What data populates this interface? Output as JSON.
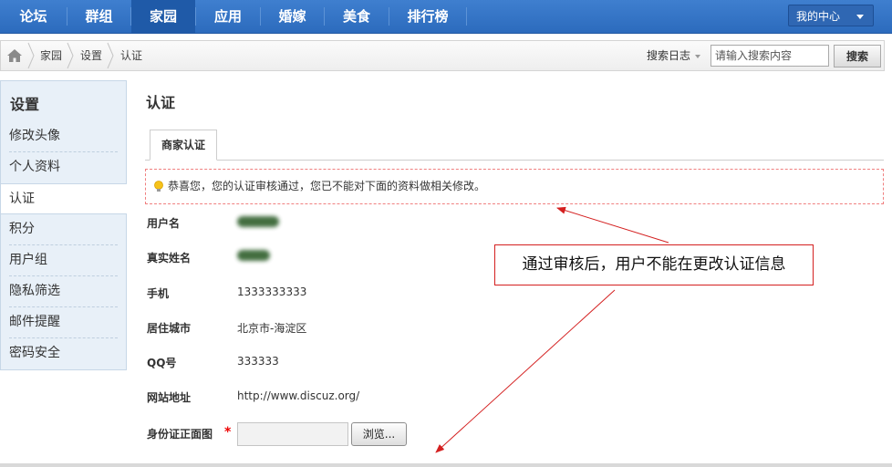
{
  "topnav": {
    "items": [
      {
        "label": "论坛"
      },
      {
        "label": "群组"
      },
      {
        "label": "家园",
        "active": true
      },
      {
        "label": "应用"
      },
      {
        "label": "婚嫁"
      },
      {
        "label": "美食"
      },
      {
        "label": "排行榜"
      }
    ],
    "my_center": "我的中心"
  },
  "breadcrumb": {
    "home_icon": "home-icon",
    "items": [
      "家园",
      "设置",
      "认证"
    ]
  },
  "search": {
    "type_label": "搜索日志",
    "placeholder": "请输入搜索内容",
    "button": "搜索"
  },
  "sidebar": {
    "title": "设置",
    "items": [
      {
        "label": "修改头像"
      },
      {
        "label": "个人资料"
      },
      {
        "label": "认证",
        "active": true
      },
      {
        "label": "积分"
      },
      {
        "label": "用户组"
      },
      {
        "label": "隐私筛选"
      },
      {
        "label": "邮件提醒"
      },
      {
        "label": "密码安全"
      }
    ]
  },
  "main": {
    "title": "认证",
    "tab": "商家认证",
    "notice_icon": "lightbulb-icon",
    "notice": "恭喜您，您的认证审核通过，您已不能对下面的资料做相关修改。",
    "fields": [
      {
        "label": "用户名",
        "value": "",
        "blurred": true
      },
      {
        "label": "真实姓名",
        "value": "",
        "blurred": true
      },
      {
        "label": "手机",
        "value": "1333333333"
      },
      {
        "label": "居住城市",
        "value": "北京市-海淀区"
      },
      {
        "label": "QQ号",
        "value": "333333"
      },
      {
        "label": "网站地址",
        "value": "http://www.discuz.org/"
      },
      {
        "label": "身份证正面图",
        "value": ""
      }
    ],
    "required_mark": "*",
    "browse_button": "浏览..."
  },
  "annotation": {
    "text": "通过审核后，用户不能在更改认证信息"
  },
  "colors": {
    "nav_bg": "#2c6bbd",
    "nav_active": "#1f5aa8",
    "sidebar_bg": "#e8f0f8",
    "notice_border": "#f07f7f",
    "annotation": "#d42020"
  }
}
